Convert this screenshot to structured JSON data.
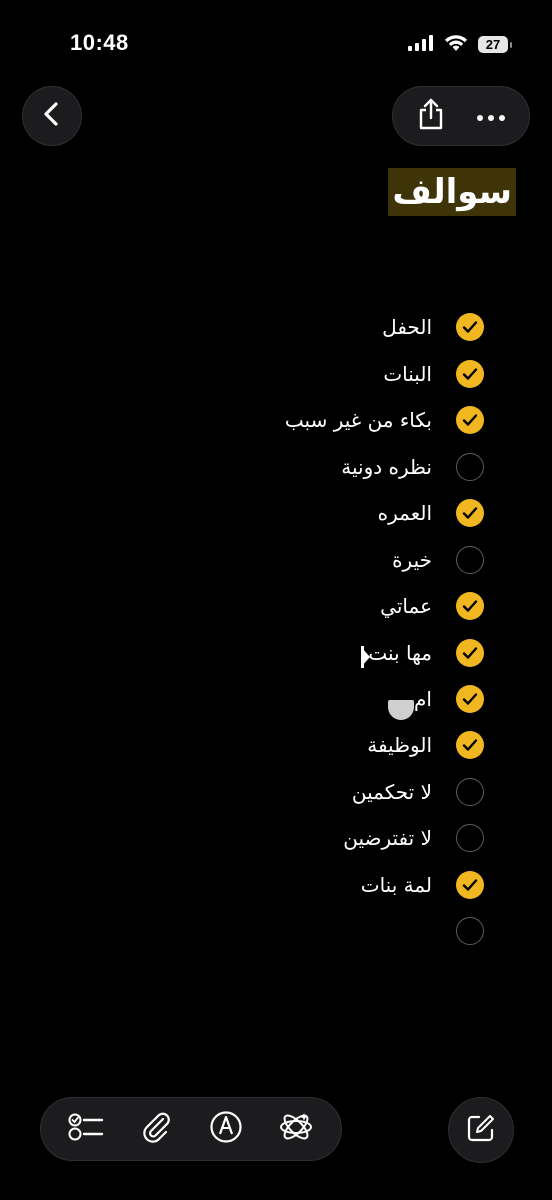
{
  "status_bar": {
    "time": "10:48",
    "battery_level": "27",
    "icons": [
      "signal-icon",
      "wifi-icon",
      "battery-icon"
    ]
  },
  "nav": {
    "back_icon": "chevron-left-icon",
    "share_icon": "share-icon",
    "more_icon": "ellipsis-icon"
  },
  "note": {
    "title": "سوالف",
    "title_highlight_color": "#3f3308"
  },
  "checklist": {
    "checked_color": "#f1b721",
    "items": [
      {
        "text": "الحفل",
        "checked": true
      },
      {
        "text": "البنات",
        "checked": true
      },
      {
        "text": "بكاء من غير سبب",
        "checked": true
      },
      {
        "text": "نظره دونية",
        "checked": false
      },
      {
        "text": "العمره",
        "checked": true
      },
      {
        "text": "خيرة",
        "checked": false
      },
      {
        "text": "عماتي",
        "checked": true
      },
      {
        "text": "مها بنت",
        "checked": true
      },
      {
        "text": "ام",
        "checked": true
      },
      {
        "text": "الوظيفة",
        "checked": true
      },
      {
        "text": "لا تحكمين",
        "checked": false
      },
      {
        "text": "لا تفترضين",
        "checked": false
      },
      {
        "text": "لمة بنات",
        "checked": true
      },
      {
        "text": "",
        "checked": false
      }
    ]
  },
  "toolbar": {
    "icons": [
      "checklist-icon",
      "paperclip-icon",
      "markup-pen-icon",
      "apple-intelligence-icon"
    ],
    "compose_icon": "compose-icon"
  }
}
